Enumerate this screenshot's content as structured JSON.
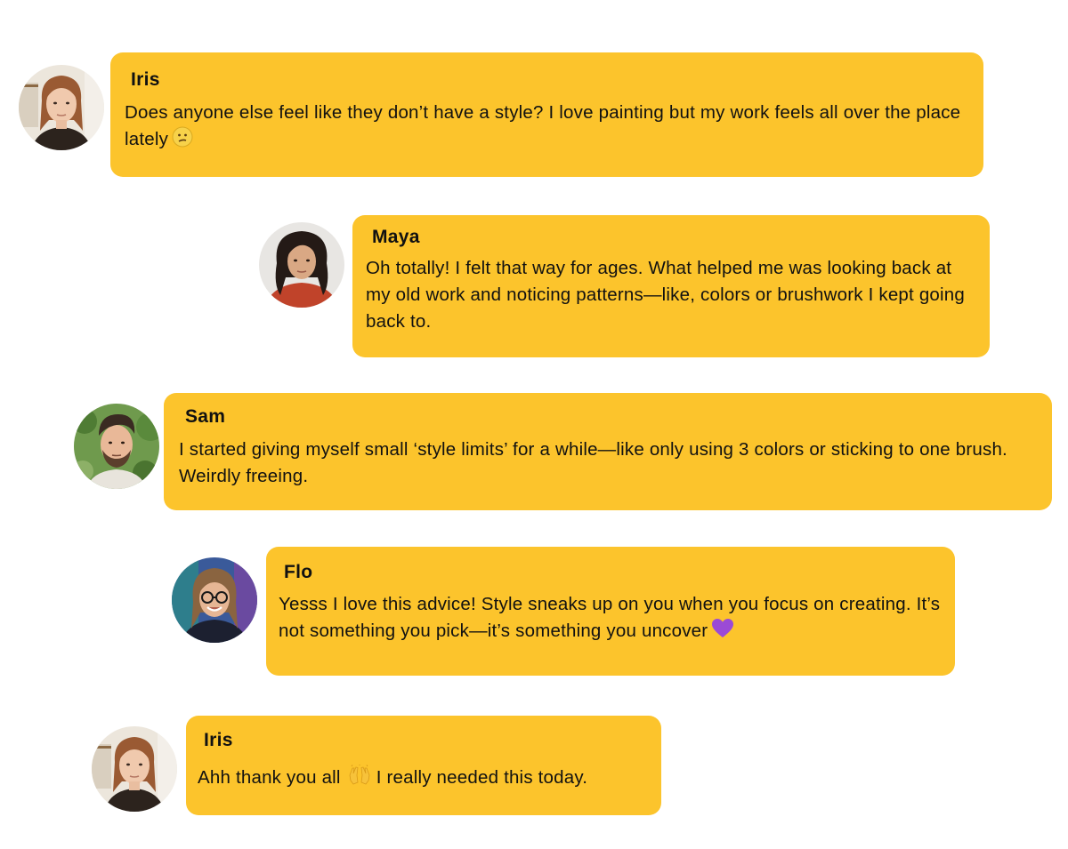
{
  "messages": [
    {
      "author": "Iris",
      "text": "Does anyone else feel like they don’t have a style? I love painting but my work feels all over the place lately",
      "emoji": "confused-face"
    },
    {
      "author": "Maya",
      "text": "Oh totally! I felt that way for ages. What helped me was looking back at my old work and noticing patterns—like, colors or brushwork I kept going back to."
    },
    {
      "author": "Sam",
      "text": "I started giving myself small ‘style limits’ for a while—like only using 3 colors or sticking to one brush. Weirdly freeing."
    },
    {
      "author": "Flo",
      "text": "Yesss I love this advice! Style sneaks up on you when you focus on creating. It’s not something you pick—it’s something you uncover",
      "emoji": "purple-heart"
    },
    {
      "author": "Iris",
      "text_before": "Ahh thank you all",
      "emoji": "raising-hands",
      "text_after": "I really needed this today."
    }
  ],
  "colors": {
    "bubble": "#fcc42c",
    "text": "#111111",
    "background": "#ffffff"
  }
}
